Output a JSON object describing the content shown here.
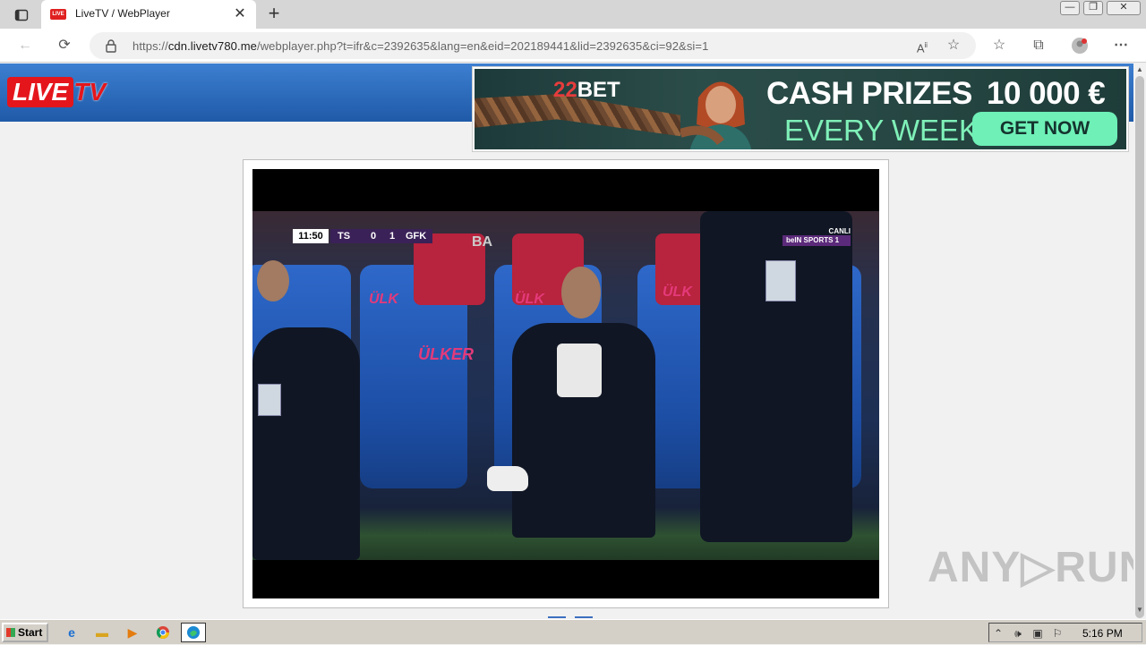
{
  "browser": {
    "tab": {
      "favicon_text": "LIVE",
      "title": "LiveTV / WebPlayer",
      "close": "✕"
    },
    "new_tab": "+",
    "window_controls": {
      "minimize": "—",
      "restore": "❐",
      "close": "✕"
    },
    "address": {
      "url_prefix": "https://",
      "url_host": "cdn.livetv780.me",
      "url_rest": "/webplayer.php?t=ifr&c=2392635&lang=en&eid=202189441&lid=2392635&ci=92&si=1"
    }
  },
  "site": {
    "logo_live": "LIVE",
    "logo_tv": "TV"
  },
  "ad": {
    "brand_num": "22",
    "brand_text": "BET",
    "headline": "CASH PRIZES",
    "amount": "10 000 €",
    "subline": "EVERY WEEK",
    "cta": "GET NOW"
  },
  "video": {
    "clock": "11:50",
    "home_team": "TS",
    "home_score": "0",
    "away_score": "1",
    "away_team": "GFK",
    "broadcaster_live": "CANLI",
    "broadcaster_logo": "beIN SPORTS 1",
    "sponsor": "ÜLKER",
    "sponsor_short": "ÜLK",
    "board_text": "BA"
  },
  "watermark": "ANY▷RUN",
  "taskbar": {
    "start_label": "Start",
    "clock": "5:16 PM"
  }
}
